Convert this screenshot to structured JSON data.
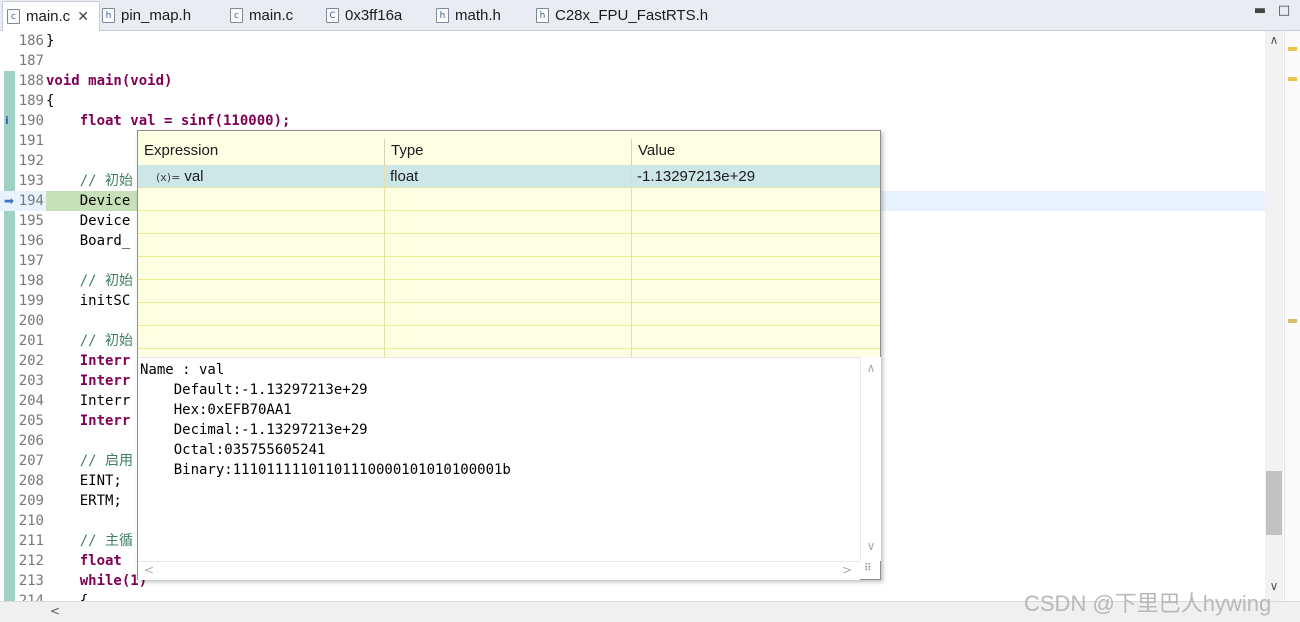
{
  "tabs": [
    {
      "label": "main.c",
      "icon": "c-file-icon",
      "glyph": "c"
    },
    {
      "label": "pin_map.h",
      "icon": "h-file-icon",
      "glyph": "h"
    },
    {
      "label": "main.c",
      "icon": "c-file-icon",
      "glyph": "c"
    },
    {
      "label": "0x3ff16a",
      "icon": "c-file-icon",
      "glyph": "C"
    },
    {
      "label": "math.h",
      "icon": "h-file-icon",
      "glyph": "h"
    },
    {
      "label": "C28x_FPU_FastRTS.h",
      "icon": "h-file-icon",
      "glyph": "h"
    }
  ],
  "window_buttons": {
    "minimize": "▬",
    "maximize": "□"
  },
  "editor": {
    "lines": [
      {
        "n": "186",
        "code": "}"
      },
      {
        "n": "187",
        "code": ""
      },
      {
        "n": "188",
        "code": "void main(void)"
      },
      {
        "n": "189",
        "code": "{"
      },
      {
        "n": "190",
        "code": "    float val = sinf(110000);"
      },
      {
        "n": "191",
        "code": ""
      },
      {
        "n": "192",
        "code": ""
      },
      {
        "n": "193",
        "code": "    // 初始"
      },
      {
        "n": "194",
        "code": "    Device"
      },
      {
        "n": "195",
        "code": "    Device"
      },
      {
        "n": "196",
        "code": "    Board_"
      },
      {
        "n": "197",
        "code": ""
      },
      {
        "n": "198",
        "code": "    // 初始"
      },
      {
        "n": "199",
        "code": "    initSC"
      },
      {
        "n": "200",
        "code": ""
      },
      {
        "n": "201",
        "code": "    // 初始"
      },
      {
        "n": "202",
        "code": "    Interr"
      },
      {
        "n": "203",
        "code": "    Interr"
      },
      {
        "n": "204",
        "code": "    Interr"
      },
      {
        "n": "205",
        "code": "    Interr"
      },
      {
        "n": "206",
        "code": ""
      },
      {
        "n": "207",
        "code": "    // 启用"
      },
      {
        "n": "208",
        "code": "    EINT;"
      },
      {
        "n": "209",
        "code": "    ERTM;"
      },
      {
        "n": "210",
        "code": ""
      },
      {
        "n": "211",
        "code": "    // 主循"
      },
      {
        "n": "212",
        "code": "    float"
      },
      {
        "n": "213",
        "code": "    while(1)"
      },
      {
        "n": "214",
        "code": "    {"
      }
    ],
    "markers": {
      "info": "i",
      "arrow": "➡"
    }
  },
  "hover": {
    "columns": [
      "Expression",
      "Type",
      "Value"
    ],
    "row": {
      "expression": "val",
      "type": "float",
      "value": "-1.13297213e+29",
      "icon": "(x)="
    },
    "details": [
      "Name : val",
      "    Default:-1.13297213e+29",
      "    Hex:0xEFB70AA1",
      "    Decimal:-1.13297213e+29",
      "    Octal:035755605241",
      "    Binary:11101111101101110000101010100001b"
    ]
  },
  "scroll_arrows": {
    "up": "∧",
    "down": "∨",
    "left": "<",
    "right": ">"
  },
  "watermark": "CSDN @下里巴人hywing"
}
